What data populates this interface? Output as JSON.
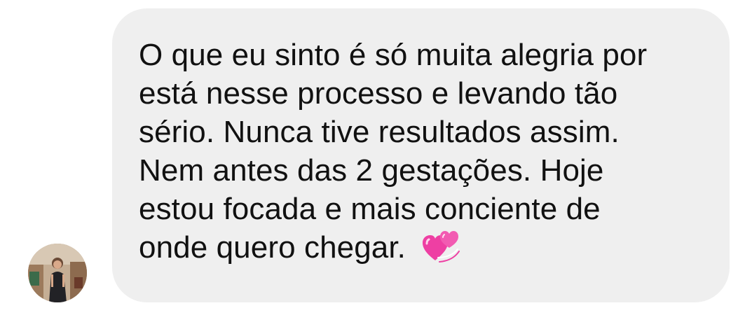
{
  "message": {
    "text": "O que eu sinto é só muita alegria por\nestá nesse processo e levando tão\nsério. Nunca tive resultados assim.\nNem antes das 2 gestações. Hoje\nestou focada e mais conciente de\nonde quero chegar.",
    "emoji_icon": "two-hearts-icon"
  },
  "sender": {
    "avatar_icon": "avatar-photo"
  },
  "colors": {
    "bubble": "#efefef",
    "text": "#111111",
    "heart_pink": "#ee3fa3"
  }
}
